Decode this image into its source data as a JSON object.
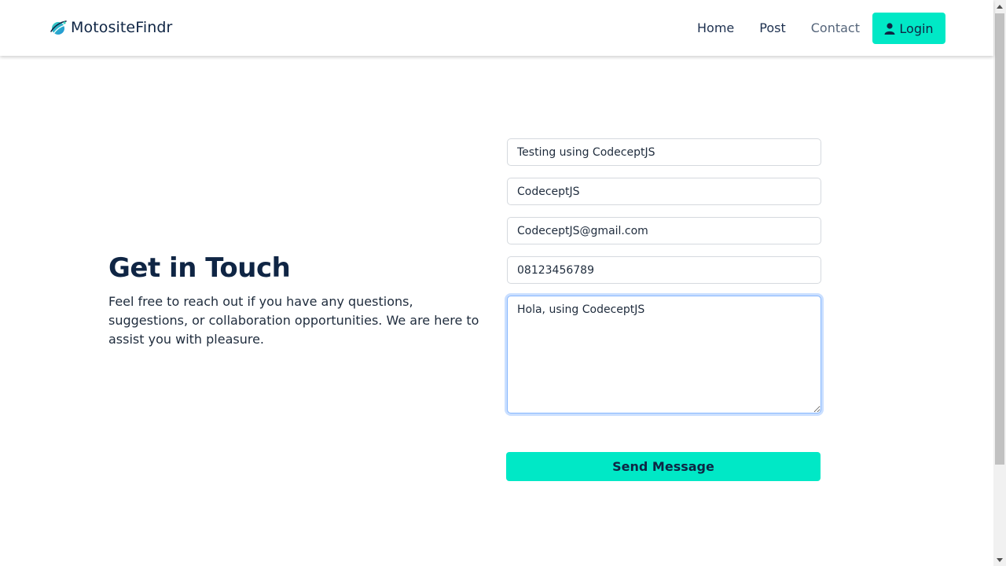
{
  "navbar": {
    "brand": "MotositeFindr",
    "brand_icon": "planet-logo-icon",
    "links": [
      "Home",
      "Post",
      "Contact"
    ],
    "login_label": "Login",
    "login_icon": "user-icon"
  },
  "intro": {
    "title": "Get in Touch",
    "description": "Feel free to reach out if you have any questions, suggestions, or collaboration opportunities. We are here to assist you with pleasure."
  },
  "form": {
    "subject": "Testing using CodeceptJS",
    "name": "CodeceptJS",
    "email": "CodeceptJS@gmail.com",
    "phone": "08123456789",
    "message": "Hola, using CodeceptJS",
    "submit_label": "Send Message"
  },
  "colors": {
    "accent": "#00e8c6",
    "heading": "#0f2544",
    "focus_border": "#86b7fe"
  }
}
